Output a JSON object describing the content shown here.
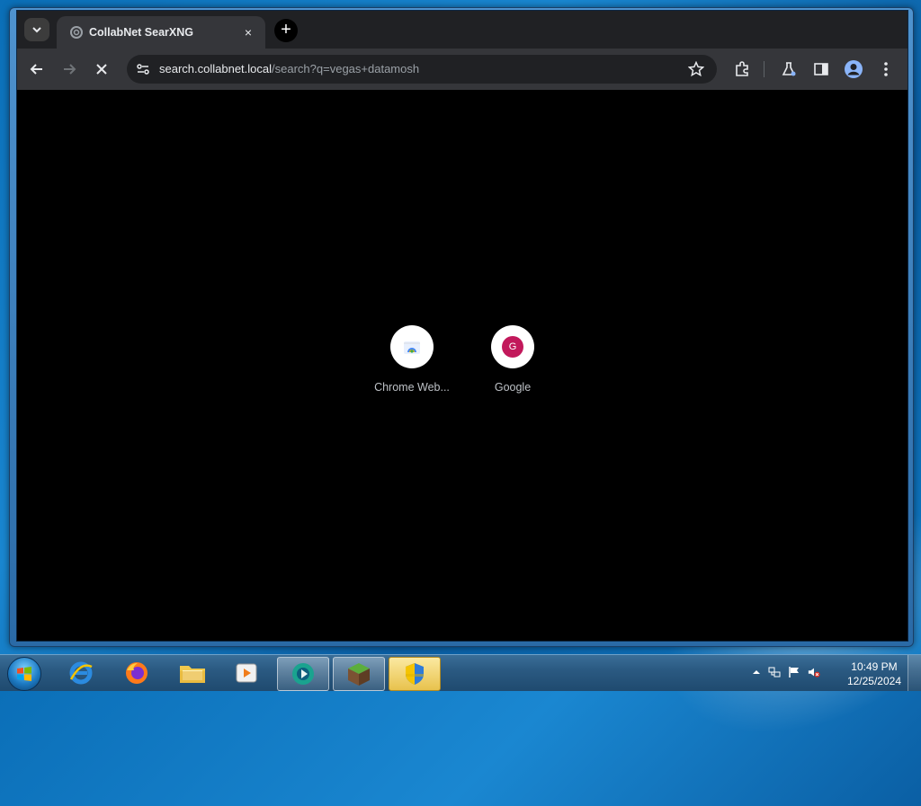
{
  "browser": {
    "tab": {
      "title": "CollabNet SearXNG",
      "close_glyph": "×"
    },
    "new_tab_glyph": "+",
    "omnibox": {
      "host": "search.collabnet.local",
      "path": "/search?q=vegas+datamosh"
    },
    "window_controls": {
      "minimize": "▁",
      "maximize": "▢",
      "close": "✕"
    }
  },
  "shortcuts": [
    {
      "label": "Chrome Web...",
      "icon": "chrome-web-store-icon"
    },
    {
      "label": "Google",
      "icon": "google-letter-icon",
      "letter": "G",
      "letter_color": "#c2185b"
    }
  ],
  "taskbar": {
    "apps": [
      {
        "name": "internet-explorer"
      },
      {
        "name": "firefox"
      },
      {
        "name": "file-explorer"
      },
      {
        "name": "media-player"
      },
      {
        "name": "chrome-like-app"
      },
      {
        "name": "minecraft"
      },
      {
        "name": "security-shield"
      }
    ],
    "clock": {
      "time": "10:49 PM",
      "date": "12/25/2024"
    }
  },
  "colors": {
    "chrome_dark": "#202124",
    "chrome_toolbar": "#35363a",
    "content_bg": "#000000",
    "desktop": "#1a87d1"
  }
}
